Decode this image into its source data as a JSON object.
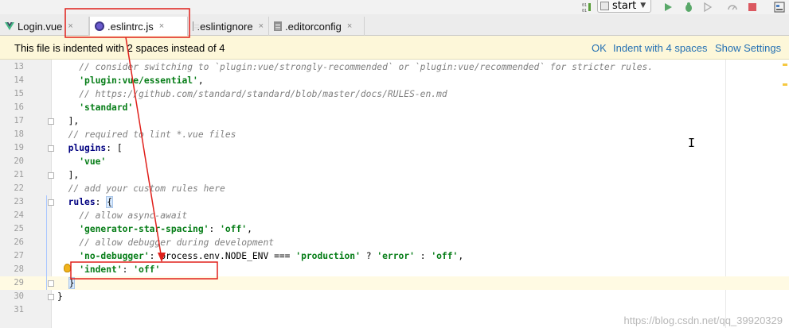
{
  "toolbar": {
    "run_config_label": "start",
    "icons": [
      "binary-icon",
      "run-config-icon",
      "run-icon",
      "debug-icon",
      "coverage-icon",
      "profile-icon",
      "attach-icon",
      "stop-icon",
      "structure-icon"
    ]
  },
  "tabs": [
    {
      "label": "Login.vue",
      "icon": "vue-icon",
      "active": false
    },
    {
      "label": ".eslintrc.js",
      "icon": "eslint-icon",
      "active": true
    },
    {
      "label": ".eslintignore",
      "icon": "file-icon",
      "active": false
    },
    {
      "label": ".editorconfig",
      "icon": "file-icon",
      "active": false
    }
  ],
  "notification": {
    "message": "This file is indented with 2 spaces instead of 4",
    "actions": [
      "OK",
      "Indent with 4 spaces",
      "Show Settings"
    ]
  },
  "editor": {
    "lines": [
      {
        "n": "13",
        "parts": [
          [
            "c",
            "    // consider switching to `plugin:vue/strongly-recommended` or `plugin:vue/recommended` for stricter rules."
          ]
        ]
      },
      {
        "n": "14",
        "parts": [
          [
            "p",
            "    "
          ],
          [
            "s",
            "'plugin:vue/essential'"
          ],
          [
            "p",
            ","
          ]
        ]
      },
      {
        "n": "15",
        "parts": [
          [
            "c",
            "    // https://github.com/standard/standard/blob/master/docs/RULES-en.md"
          ]
        ]
      },
      {
        "n": "16",
        "parts": [
          [
            "p",
            "    "
          ],
          [
            "s",
            "'standard'"
          ]
        ]
      },
      {
        "n": "17",
        "parts": [
          [
            "p",
            "  ],"
          ]
        ]
      },
      {
        "n": "18",
        "parts": [
          [
            "c",
            "  // required to lint *.vue files"
          ]
        ]
      },
      {
        "n": "19",
        "parts": [
          [
            "p",
            "  "
          ],
          [
            "k",
            "plugins"
          ],
          [
            "p",
            ": ["
          ]
        ]
      },
      {
        "n": "20",
        "parts": [
          [
            "p",
            "    "
          ],
          [
            "s",
            "'vue'"
          ]
        ]
      },
      {
        "n": "21",
        "parts": [
          [
            "p",
            "  ],"
          ]
        ]
      },
      {
        "n": "22",
        "parts": [
          [
            "c",
            "  // add your custom rules here"
          ]
        ]
      },
      {
        "n": "23",
        "parts": [
          [
            "p",
            "  "
          ],
          [
            "k",
            "rules"
          ],
          [
            "p",
            ": "
          ],
          [
            "b",
            "{"
          ]
        ]
      },
      {
        "n": "24",
        "parts": [
          [
            "c",
            "    // allow async-await"
          ]
        ]
      },
      {
        "n": "25",
        "parts": [
          [
            "p",
            "    "
          ],
          [
            "s",
            "'generator-star-spacing'"
          ],
          [
            "p",
            ": "
          ],
          [
            "s",
            "'off'"
          ],
          [
            "p",
            ","
          ]
        ]
      },
      {
        "n": "26",
        "parts": [
          [
            "c",
            "    // allow debugger during development"
          ]
        ]
      },
      {
        "n": "27",
        "parts": [
          [
            "p",
            "    "
          ],
          [
            "s",
            "'no-debugger'"
          ],
          [
            "p",
            ": process.env.NODE_ENV === "
          ],
          [
            "s",
            "'production'"
          ],
          [
            "p",
            " ? "
          ],
          [
            "s",
            "'error'"
          ],
          [
            "p",
            " : "
          ],
          [
            "s",
            "'off'"
          ],
          [
            "p",
            ","
          ]
        ]
      },
      {
        "n": "28",
        "parts": [
          [
            "p",
            "    "
          ],
          [
            "s",
            "'indent'"
          ],
          [
            "p",
            ": "
          ],
          [
            "s",
            "'off'"
          ]
        ]
      },
      {
        "n": "29",
        "parts": [
          [
            "p",
            "  "
          ],
          [
            "b",
            "}"
          ]
        ]
      },
      {
        "n": "30",
        "parts": [
          [
            "p",
            "}"
          ]
        ]
      },
      {
        "n": "31",
        "parts": []
      }
    ],
    "current_line": "29"
  },
  "watermark": "https://blog.csdn.net/qq_39920329",
  "colors": {
    "annotation_red": "#e0201b",
    "notification_bg": "#fdf7d9",
    "link": "#2470b3",
    "string": "#067d17",
    "keyword": "#000080",
    "comment": "#808080"
  }
}
